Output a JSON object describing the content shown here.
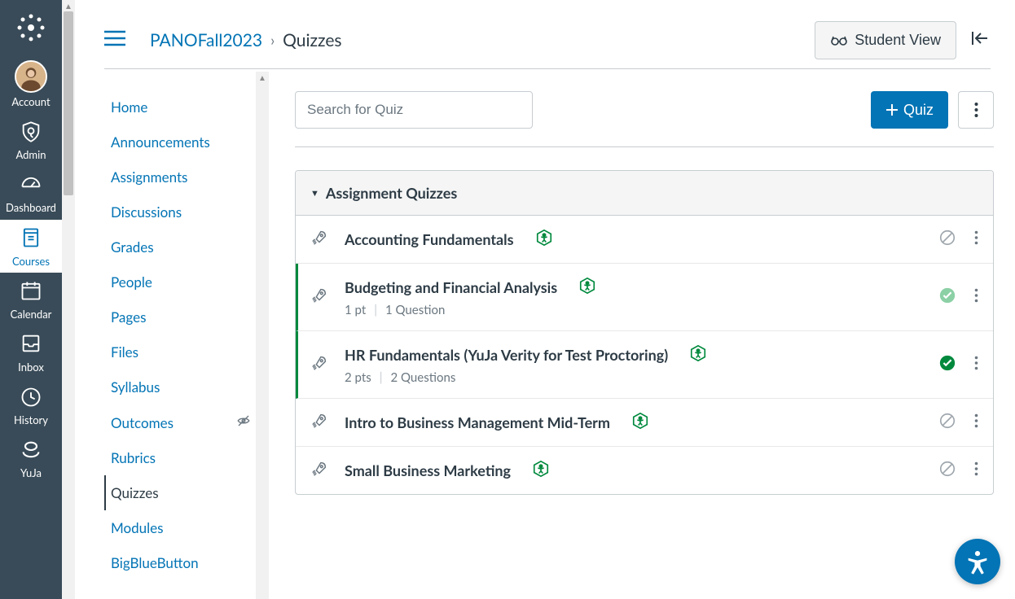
{
  "globalNav": {
    "items": [
      {
        "label": "Account"
      },
      {
        "label": "Admin"
      },
      {
        "label": "Dashboard"
      },
      {
        "label": "Courses"
      },
      {
        "label": "Calendar"
      },
      {
        "label": "Inbox"
      },
      {
        "label": "History"
      },
      {
        "label": "YuJa"
      }
    ]
  },
  "breadcrumb": {
    "course": "PANOFall2023",
    "current": "Quizzes"
  },
  "header": {
    "studentView": "Student View"
  },
  "courseNav": {
    "items": [
      {
        "label": "Home"
      },
      {
        "label": "Announcements"
      },
      {
        "label": "Assignments"
      },
      {
        "label": "Discussions"
      },
      {
        "label": "Grades"
      },
      {
        "label": "People"
      },
      {
        "label": "Pages"
      },
      {
        "label": "Files"
      },
      {
        "label": "Syllabus"
      },
      {
        "label": "Outcomes"
      },
      {
        "label": "Rubrics"
      },
      {
        "label": "Quizzes"
      },
      {
        "label": "Modules"
      },
      {
        "label": "BigBlueButton"
      }
    ]
  },
  "toolbar": {
    "searchPlaceholder": "Search for Quiz",
    "addQuiz": "Quiz"
  },
  "group": {
    "title": "Assignment Quizzes"
  },
  "quizzes": [
    {
      "title": "Accounting Fundamentals",
      "points": "",
      "questions": "",
      "published": false,
      "hasMeta": false,
      "lightCheck": false
    },
    {
      "title": "Budgeting and Financial Analysis",
      "points": "1 pt",
      "questions": "1 Question",
      "published": true,
      "hasMeta": true,
      "lightCheck": true
    },
    {
      "title": "HR Fundamentals (YuJa Verity for Test Proctoring)",
      "points": "2 pts",
      "questions": "2 Questions",
      "published": true,
      "hasMeta": true,
      "lightCheck": false
    },
    {
      "title": "Intro to Business Management Mid-Term",
      "points": "",
      "questions": "",
      "published": false,
      "hasMeta": false,
      "lightCheck": false
    },
    {
      "title": "Small Business Marketing",
      "points": "",
      "questions": "",
      "published": false,
      "hasMeta": false,
      "lightCheck": false
    }
  ]
}
